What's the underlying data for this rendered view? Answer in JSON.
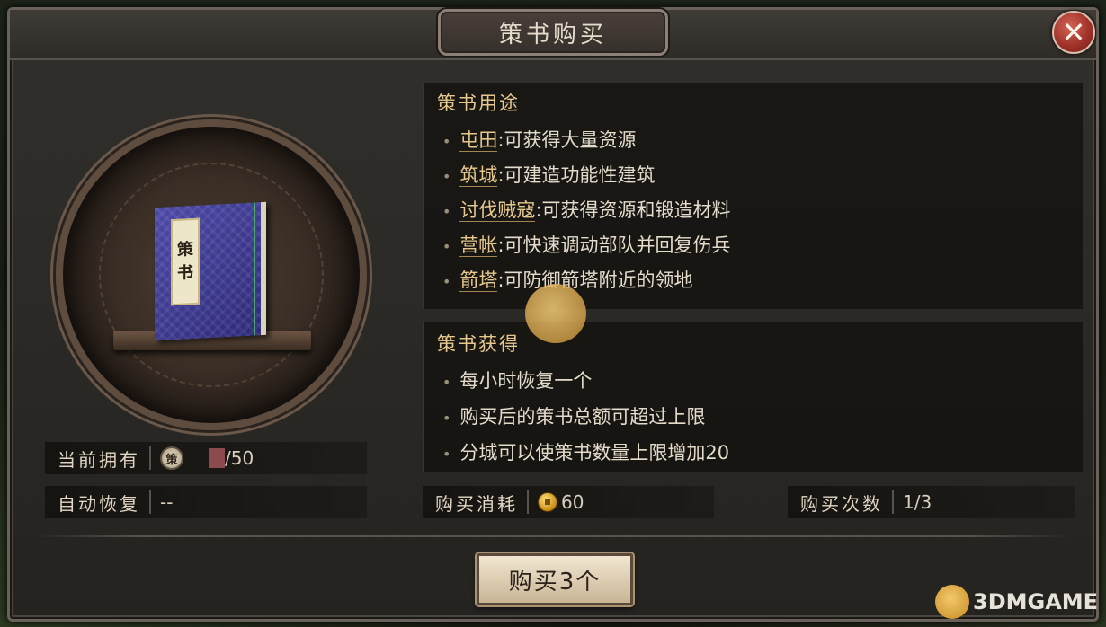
{
  "dialog": {
    "title": "策书购买",
    "close_icon": "close-icon"
  },
  "item": {
    "book_label": [
      "策",
      "书"
    ]
  },
  "stats": {
    "owned_label": "当前拥有",
    "owned_badge": "策",
    "owned_max": "/50",
    "recover_label": "自动恢复",
    "recover_value": "--",
    "cost_label": "购买消耗",
    "cost_value": "60",
    "count_label": "购买次数",
    "count_value": "1/3"
  },
  "usage": {
    "heading": "策书用途",
    "items": [
      {
        "keyword": "屯田",
        "desc": ":可获得大量资源"
      },
      {
        "keyword": "筑城",
        "desc": ":可建造功能性建筑"
      },
      {
        "keyword": "讨伐贼寇",
        "desc": ":可获得资源和锻造材料"
      },
      {
        "keyword": "营帐",
        "desc": ":可快速调动部队并回复伤兵"
      },
      {
        "keyword": "箭塔",
        "desc": ":可防御箭塔附近的领地"
      }
    ]
  },
  "obtain": {
    "heading": "策书获得",
    "items": [
      "每小时恢复一个",
      "购买后的策书总额可超过上限",
      "分城可以使策书数量上限增加20"
    ]
  },
  "buy_button": "购买3个",
  "watermark": "3DMGAME",
  "colors": {
    "accent_gold": "#e6c88d",
    "close_red": "#a1322a",
    "book_blue": "#3d3a92"
  }
}
